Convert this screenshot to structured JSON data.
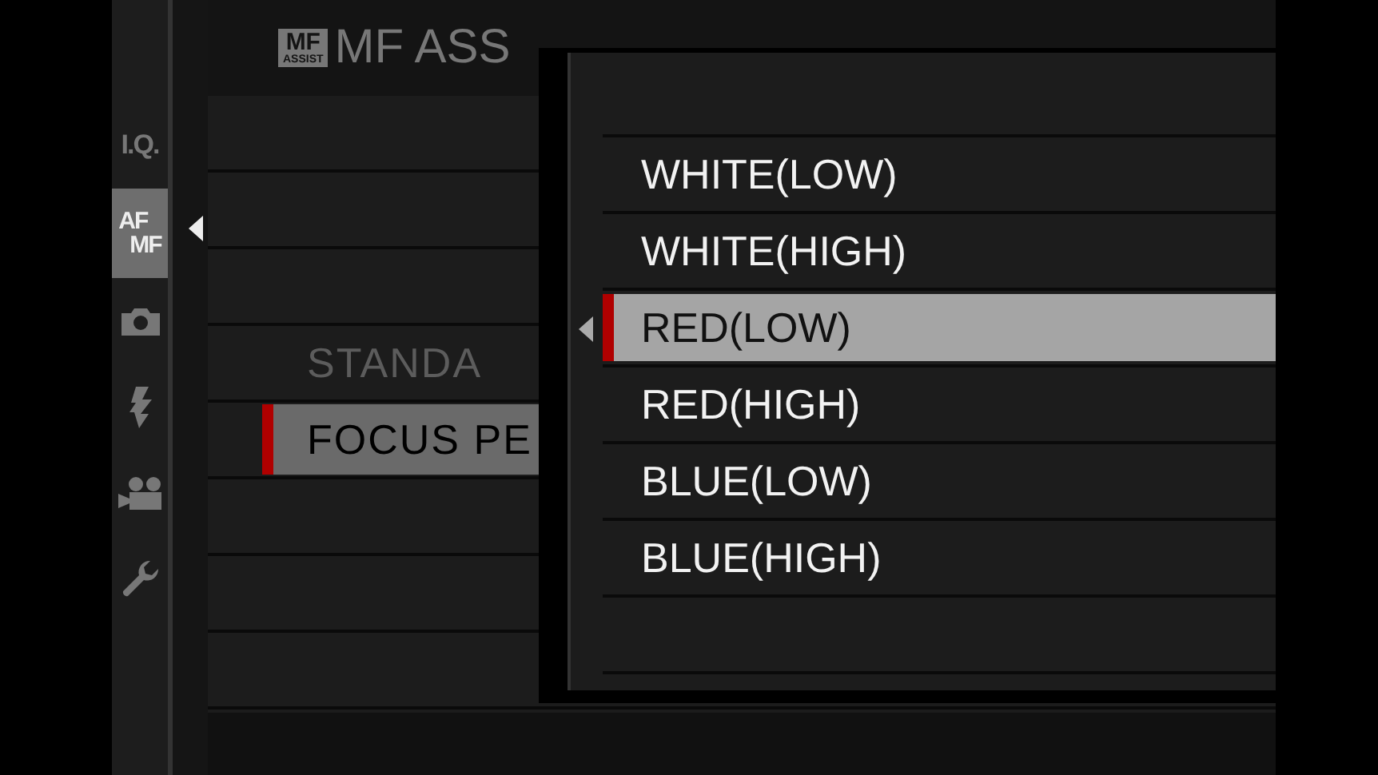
{
  "sidebar": {
    "tabs": [
      {
        "kind": "text",
        "label": "I.Q.",
        "selected": false
      },
      {
        "kind": "stacked",
        "label": "AF",
        "label2": "MF",
        "selected": true
      },
      {
        "kind": "camera",
        "selected": false
      },
      {
        "kind": "flash",
        "selected": false
      },
      {
        "kind": "movie",
        "selected": false
      },
      {
        "kind": "wrench",
        "selected": false
      }
    ]
  },
  "header": {
    "badge_top": "MF",
    "badge_bottom": "ASSIST",
    "title": "MF ASS"
  },
  "menu": {
    "rows": [
      {
        "label": "STANDA",
        "selected": false,
        "disabled": true
      },
      {
        "label": "FOCUS PE",
        "selected": true,
        "disabled": false
      }
    ]
  },
  "popup": {
    "options": [
      {
        "label": "WHITE(LOW)",
        "selected": false
      },
      {
        "label": "WHITE(HIGH)",
        "selected": false
      },
      {
        "label": "RED(LOW)",
        "selected": true
      },
      {
        "label": "RED(HIGH)",
        "selected": false
      },
      {
        "label": "BLUE(LOW)",
        "selected": false
      },
      {
        "label": "BLUE(HIGH)",
        "selected": false
      }
    ]
  }
}
